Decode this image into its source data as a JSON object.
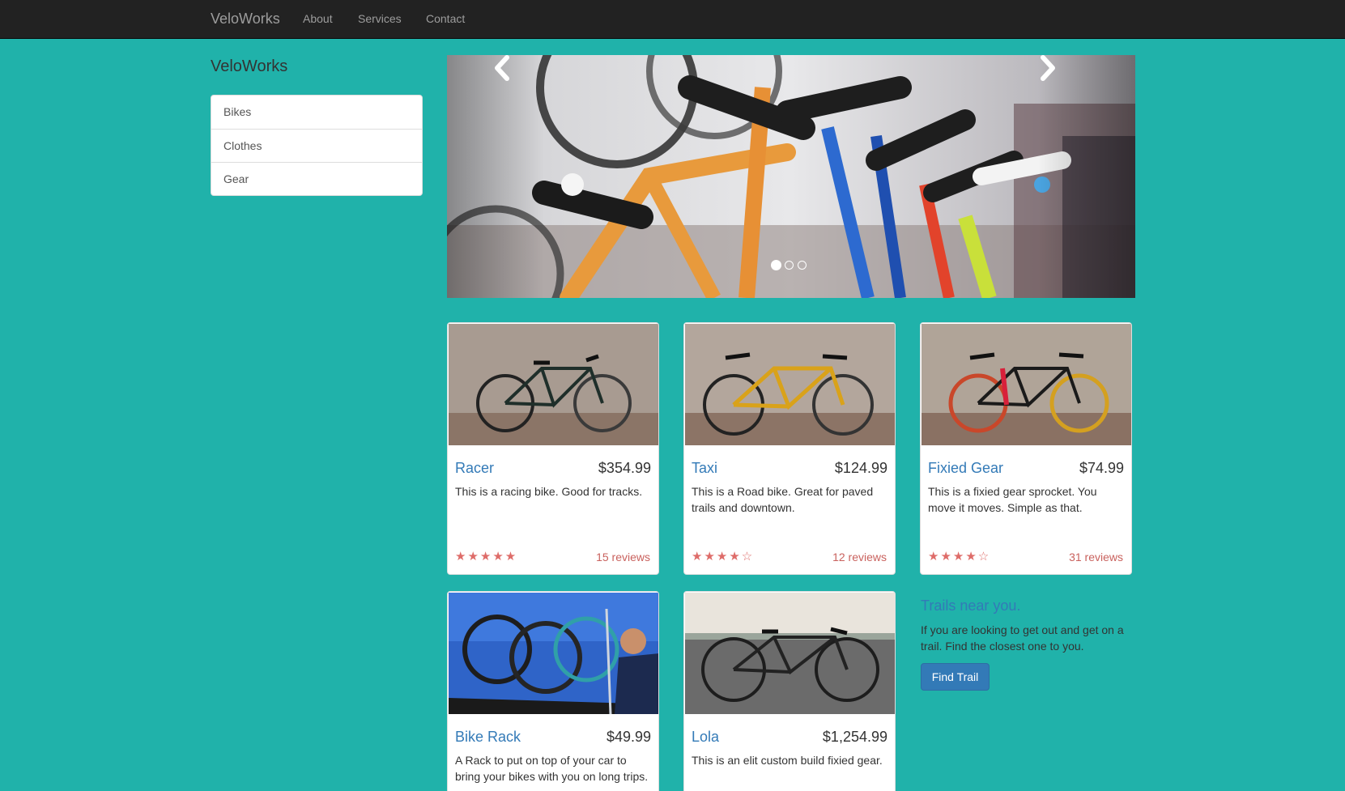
{
  "navbar": {
    "brand": "VeloWorks",
    "links": [
      "About",
      "Services",
      "Contact"
    ]
  },
  "sidebar": {
    "title": "VeloWorks",
    "items": [
      "Bikes",
      "Clothes",
      "Gear"
    ]
  },
  "carousel": {
    "slide_count": 3,
    "active_index": 0,
    "prev_icon": "chevron-left-icon",
    "next_icon": "chevron-right-icon"
  },
  "products": [
    {
      "name": "Racer",
      "price": "$354.99",
      "description": "This is a racing bike. Good for tracks.",
      "stars": "★★★★★",
      "rating": 5,
      "reviews": "15 reviews"
    },
    {
      "name": "Taxi",
      "price": "$124.99",
      "description": "This is a Road bike. Great for paved trails and downtown.",
      "stars": "★★★★☆",
      "rating": 4,
      "reviews": "12 reviews"
    },
    {
      "name": "Fixied Gear",
      "price": "$74.99",
      "description": "This is a fixied gear sprocket. You move it moves. Simple as that.",
      "stars": "★★★★☆",
      "rating": 4,
      "reviews": "31 reviews"
    },
    {
      "name": "Bike Rack",
      "price": "$49.99",
      "description": "A Rack to put on top of your car to bring your bikes with you on long trips."
    },
    {
      "name": "Lola",
      "price": "$1,254.99",
      "description": "This is an elit custom build fixied gear."
    }
  ],
  "trails": {
    "title": "Trails near you.",
    "text": "If you are looking to get out and get on a trail. Find the closest one to you.",
    "button": "Find Trail"
  },
  "colors": {
    "page_background": "#20b2aa",
    "navbar": "#222222",
    "link": "#337ab7",
    "star": "#d9534f",
    "button": "#337ab7"
  }
}
